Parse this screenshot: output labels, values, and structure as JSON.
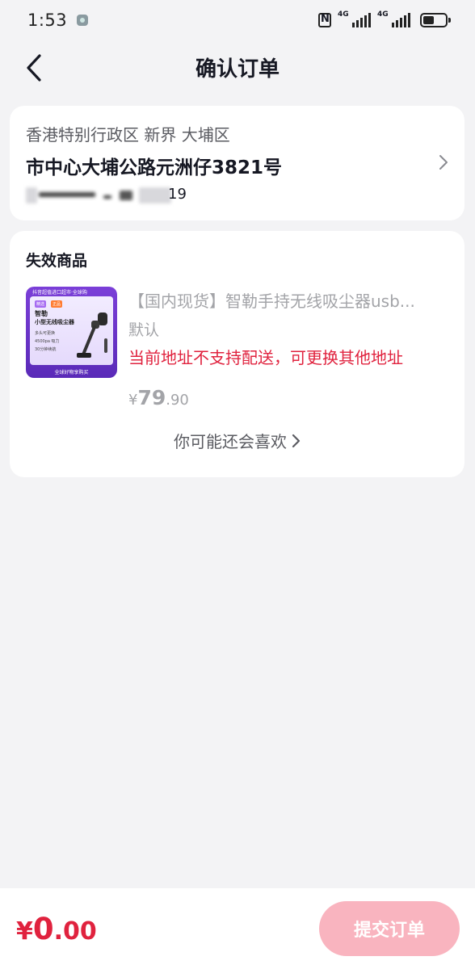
{
  "status_bar": {
    "time": "1:53",
    "network_1": "4G",
    "network_2": "4G",
    "icons": [
      "nfc-icon",
      "signal-icon",
      "signal-icon",
      "battery-icon"
    ]
  },
  "header": {
    "title": "确认订单",
    "back_icon": "chevron-left-icon"
  },
  "address": {
    "region": "香港特别行政区 新界 大埔区",
    "detail": "市中心大埔公路元洲仔3821号",
    "contact_visible_fragment": "19",
    "chevron_icon": "chevron-right-icon"
  },
  "invalid_goods": {
    "section_title": "失效商品",
    "product": {
      "name": "【国内现货】智勒手持无线吸尘器usb...",
      "spec": "默认",
      "warning": "当前地址不支持配送，可更换其他地址",
      "price_currency": "¥",
      "price_int": "79",
      "price_dec": ".90",
      "thumbnail": {
        "banner": "抖音超值进口超市·全球购",
        "tag1": "精选",
        "tag2": "正品",
        "brand": "智勒",
        "name": "小型无线吸尘器",
        "features": [
          "多头可更换",
          "4500pa 吸力",
          "30分钟续航"
        ],
        "footer": "全球好物享购买"
      }
    },
    "recommend_label": "你可能还会喜欢",
    "recommend_icon": "chevron-right-icon"
  },
  "bottom_bar": {
    "total_currency": "¥",
    "total_int": "0",
    "total_dec": ".00",
    "submit_label": "提交订单"
  },
  "colors": {
    "accent_red": "#e0223e",
    "submit_disabled": "#f9b4bf",
    "background": "#f3f3f5"
  }
}
